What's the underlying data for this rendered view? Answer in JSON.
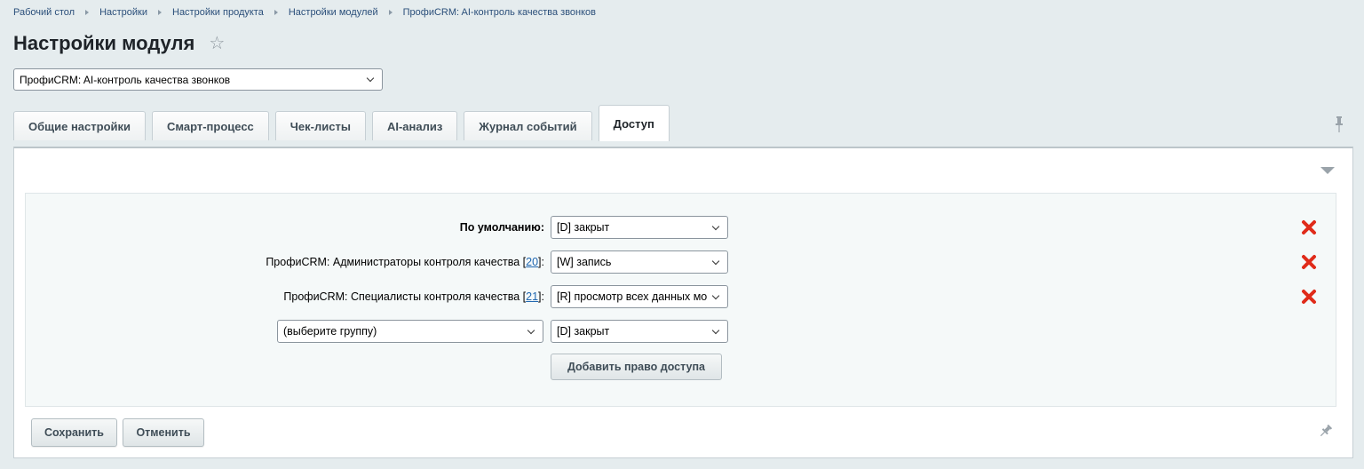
{
  "breadcrumb": [
    "Рабочий стол",
    "Настройки",
    "Настройки продукта",
    "Настройки модулей",
    "ПрофиCRM: AI-контроль качества звонков"
  ],
  "page_title": "Настройки модуля",
  "module_select": "ПрофиCRM: AI-контроль качества звонков",
  "tabs": [
    "Общие настройки",
    "Смарт-процесс",
    "Чек-листы",
    "AI-анализ",
    "Журнал событий",
    "Доступ"
  ],
  "active_tab": "Доступ",
  "access": {
    "default_label": "По умолчанию:",
    "default_value": "[D] закрыт",
    "rows": [
      {
        "label_prefix": "ПрофиCRM: Администраторы контроля качества [",
        "group_id": "20",
        "label_suffix": "]:",
        "value": "[W] запись"
      },
      {
        "label_prefix": "ПрофиCRM: Специалисты контроля качества [",
        "group_id": "21",
        "label_suffix": "]:",
        "value": "[R] просмотр всех данных мо"
      }
    ],
    "new_group_placeholder": "(выберите группу)",
    "new_value": "[D] закрыт",
    "add_button": "Добавить право доступа"
  },
  "buttons": {
    "save": "Сохранить",
    "cancel": "Отменить"
  },
  "colors": {
    "delete_icon": "#e02b1a",
    "link": "#2067b0",
    "background": "#e5ecee"
  },
  "icons": {
    "favorite": "star-icon",
    "delete": "red-x-icon",
    "pin": "pin-icon",
    "collapse": "triangle-down-icon"
  }
}
